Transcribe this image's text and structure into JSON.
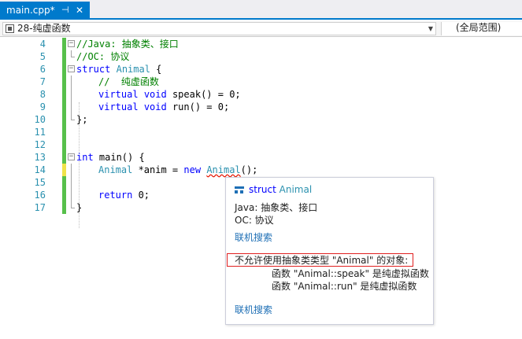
{
  "tab": {
    "title": "main.cpp*",
    "pin_glyph": "⊣",
    "close_glyph": "✕"
  },
  "nav": {
    "scope_left": "28-纯虚函数",
    "scope_right": "(全局范围)"
  },
  "code_lines": [
    {
      "num": "4"
    },
    {
      "num": "5"
    },
    {
      "num": "6"
    },
    {
      "num": "7"
    },
    {
      "num": "8"
    },
    {
      "num": "9"
    },
    {
      "num": "10"
    },
    {
      "num": "11"
    },
    {
      "num": "12"
    },
    {
      "num": "13"
    },
    {
      "num": "14"
    },
    {
      "num": "15"
    },
    {
      "num": "16"
    },
    {
      "num": "17"
    }
  ],
  "code": {
    "l4": "//Java: 抽象类、接口",
    "l5": "//OC: 协议",
    "l6_kw": "struct",
    "l6_ty": "Animal",
    "l6_rest": " {",
    "l7": "//  纯虚函数",
    "l8_kw1": "virtual",
    "l8_kw2": "void",
    "l8_rest": " speak() = 0;",
    "l9_kw1": "virtual",
    "l9_kw2": "void",
    "l9_rest": " run() = 0;",
    "l10": "};",
    "l13_kw": "int",
    "l13_rest": " main() {",
    "l14_ty": "Animal",
    "l14_mid": " *anim = ",
    "l14_kw": "new",
    "l14_ty2": "Animal",
    "l14_end": "();",
    "l16_kw": "return",
    "l16_rest": " 0;",
    "l17": "}"
  },
  "tooltip": {
    "kind": "struct",
    "name": "Animal",
    "desc1": "Java: 抽象类、接口",
    "desc2": "OC: 协议",
    "link1": "联机搜索",
    "error": "不允许使用抽象类类型 \"Animal\" 的对象:",
    "detail1": "函数 \"Animal::speak\" 是纯虚拟函数",
    "detail2": "函数 \"Animal::run\" 是纯虚拟函数",
    "link2": "联机搜索"
  },
  "colors": {
    "accent": "#007acc",
    "keyword": "#0000ff",
    "type": "#2b91af",
    "comment": "#008000",
    "error": "#e01f1f",
    "changed": "#57c04b",
    "unsaved": "#efe34a"
  }
}
